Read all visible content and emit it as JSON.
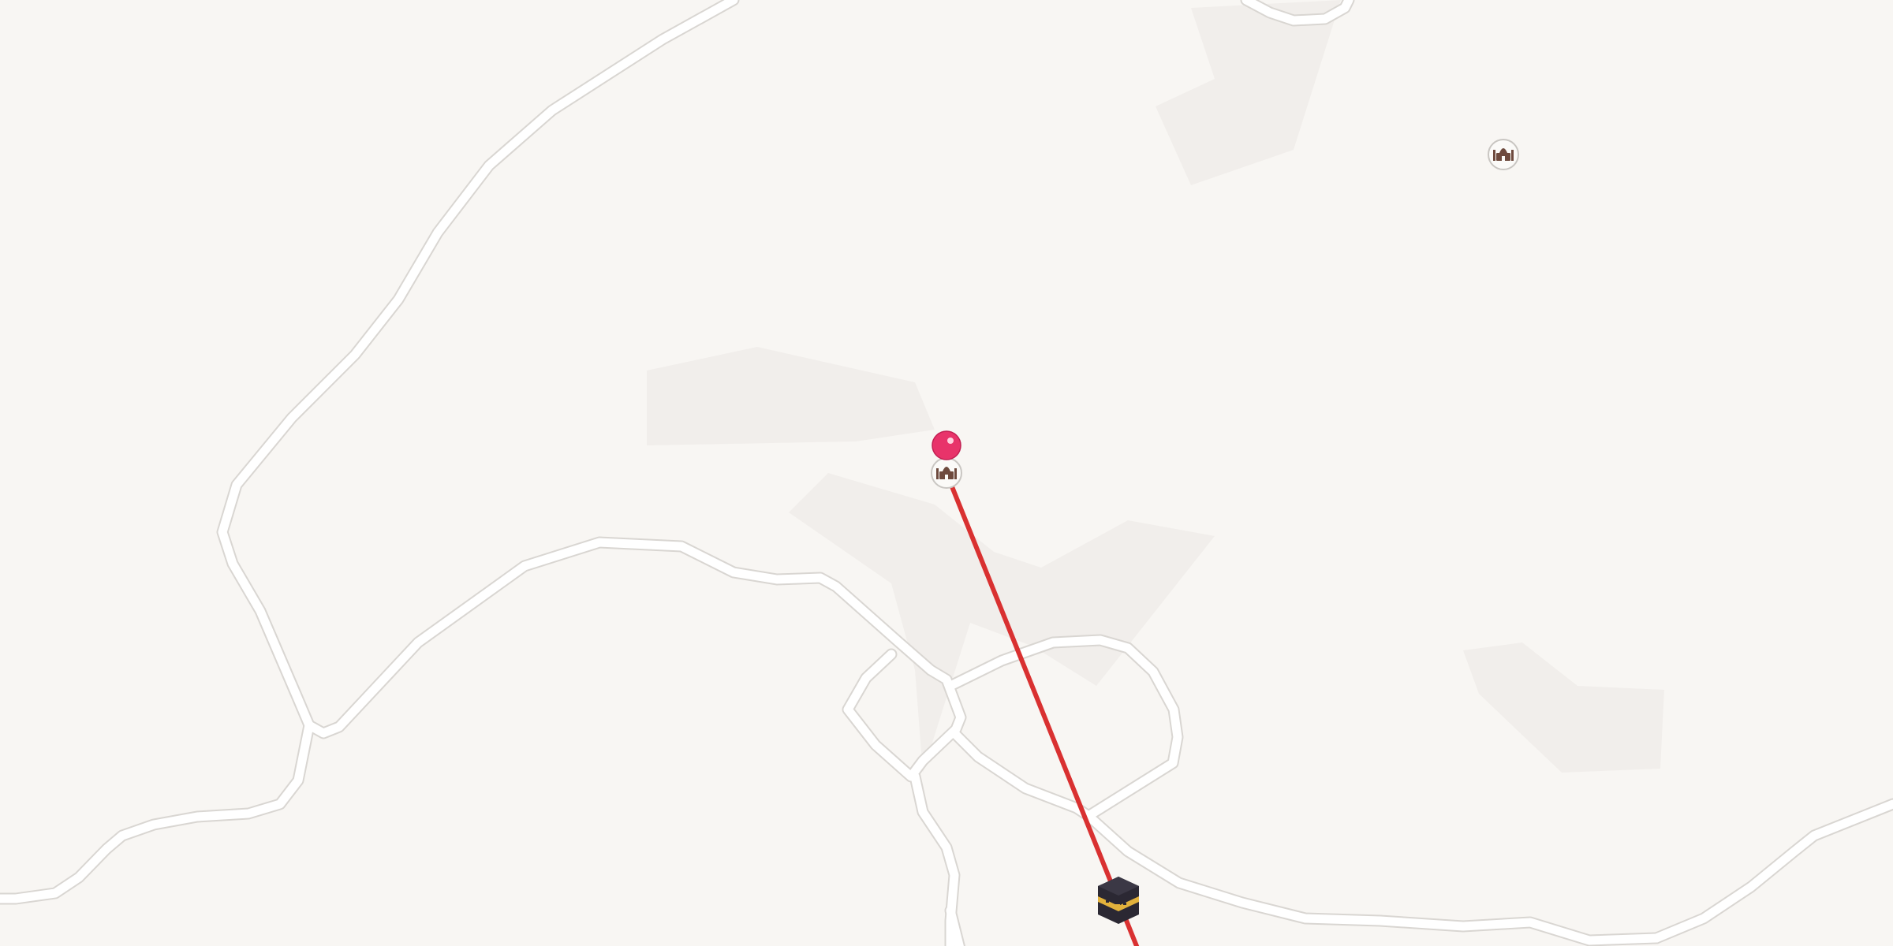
{
  "map": {
    "style": "minimal-light",
    "colors": {
      "background": "#f8f6f3",
      "road_casing": "#d9d6d2",
      "road_fill": "#ffffff",
      "area": "#f1eeeb",
      "qibla_line": "#d93131",
      "location_pin": "#e8336a"
    },
    "markers": [
      {
        "name": "current-location-pin",
        "icon": "red-pin-icon"
      },
      {
        "name": "mosque-marker-center",
        "icon": "mosque-icon"
      },
      {
        "name": "mosque-marker-north",
        "icon": "mosque-icon"
      },
      {
        "name": "kaaba-marker",
        "icon": "kaaba-icon"
      }
    ],
    "overlay": {
      "qibla_direction_line": true
    }
  }
}
